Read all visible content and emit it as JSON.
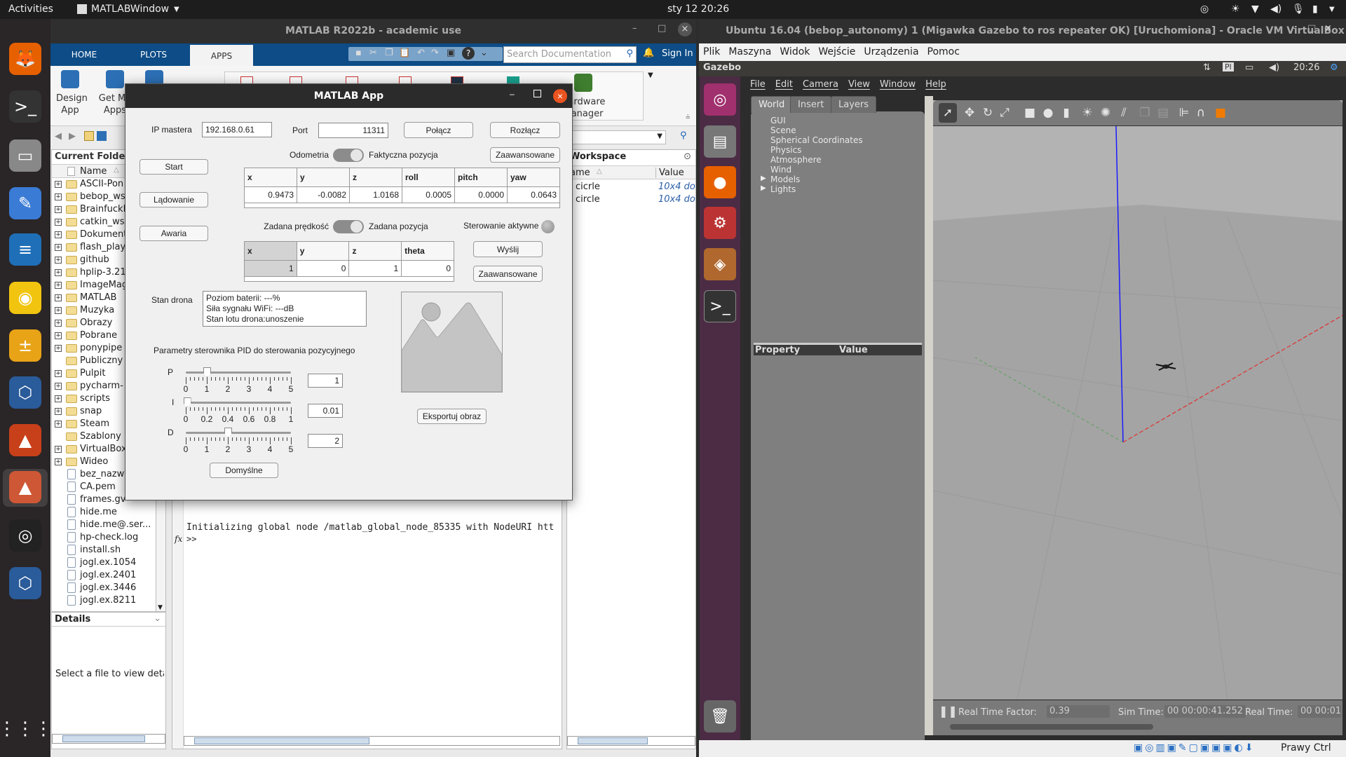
{
  "topbar": {
    "activities": "Activities",
    "app_menu": "MATLABWindow",
    "clock": "sty 12  20:26"
  },
  "dock": [
    {
      "name": "firefox-icon",
      "glyph": "🦊",
      "bg": "#e66000"
    },
    {
      "name": "terminal-icon",
      "glyph": ">_",
      "bg": "#333"
    },
    {
      "name": "files-icon",
      "glyph": "▭",
      "bg": "#888"
    },
    {
      "name": "text-editor-icon",
      "glyph": "✎",
      "bg": "#3a7bd5"
    },
    {
      "name": "writer-icon",
      "glyph": "≡",
      "bg": "#1f6fb8"
    },
    {
      "name": "rhythmbox-icon",
      "glyph": "◉",
      "bg": "#f1c40f"
    },
    {
      "name": "calculator-icon",
      "glyph": "±",
      "bg": "#e8a317"
    },
    {
      "name": "virtualbox-icon",
      "glyph": "⬡",
      "bg": "#2a5b9a"
    },
    {
      "name": "matlab-icon",
      "glyph": "▲",
      "bg": "#c8401a"
    },
    {
      "name": "matlab-active-icon",
      "glyph": "▲",
      "bg": "#c8401a"
    },
    {
      "name": "obs-icon",
      "glyph": "◎",
      "bg": "#222"
    },
    {
      "name": "virtualbox-2-icon",
      "glyph": "⬡",
      "bg": "#2a5b9a"
    }
  ],
  "matlab": {
    "title": "MATLAB R2022b - academic use",
    "tabs": [
      "HOME",
      "PLOTS",
      "APPS"
    ],
    "search_placeholder": "Search Documentation",
    "sign_in": "Sign In",
    "design_app": [
      "Design",
      "App"
    ],
    "get_more_apps": [
      "Get Mo",
      "Apps"
    ],
    "hardware_manager": [
      "Hardware",
      "Manager"
    ],
    "current_folder": "Current Folde",
    "name_col": "Name",
    "folders": [
      {
        "n": "ASCII-Pon",
        "e": 1
      },
      {
        "n": "bebop_ws",
        "e": 1
      },
      {
        "n": "BrainfuckN",
        "e": 1
      },
      {
        "n": "catkin_ws",
        "e": 1
      },
      {
        "n": "Dokument",
        "e": 1
      },
      {
        "n": "flash_play",
        "e": 1
      },
      {
        "n": "github",
        "e": 1
      },
      {
        "n": "hplip-3.21",
        "e": 1
      },
      {
        "n": "ImageMag",
        "e": 1
      },
      {
        "n": "MATLAB",
        "e": 1
      },
      {
        "n": "Muzyka",
        "e": 1
      },
      {
        "n": "Obrazy",
        "e": 1
      },
      {
        "n": "Pobrane",
        "e": 1
      },
      {
        "n": "ponypipe",
        "e": 1
      },
      {
        "n": "Publiczny",
        "e": 0
      },
      {
        "n": "Pulpit",
        "e": 1
      },
      {
        "n": "pycharm-",
        "e": 1
      },
      {
        "n": "scripts",
        "e": 1
      },
      {
        "n": "snap",
        "e": 1
      },
      {
        "n": "Steam",
        "e": 1
      },
      {
        "n": "Szablony",
        "e": 0
      },
      {
        "n": "VirtualBox",
        "e": 1
      },
      {
        "n": "Wideo",
        "e": 1
      }
    ],
    "files": [
      "bez_nazwy",
      "CA.pem",
      "frames.gv",
      "hide.me",
      "hide.me@.ser...",
      "hp-check.log",
      "install.sh",
      "jogl.ex.1054",
      "jogl.ex.2401",
      "jogl.ex.3446",
      "jogl.ex.8211"
    ],
    "details": "Details",
    "details_hint": "Select a file to view detai",
    "cmd_line": "Initializing global node /matlab_global_node_85335 with NodeURI htt",
    "prompt": ">>",
    "fx": "fx",
    "workspace": "Workspace",
    "ws_cols": [
      "ame",
      "Value"
    ],
    "ws_rows": [
      {
        "name": "cicrle",
        "value": "10x4 do"
      },
      {
        "name": "circle",
        "value": "10x4 do"
      }
    ]
  },
  "app": {
    "title": "MATLAB App",
    "ip_label": "IP mastera",
    "ip_value": "192.168.0.61",
    "port_label": "Port",
    "port_value": "11311",
    "connect": "Połącz",
    "disconnect": "Rozłącz",
    "start": "Start",
    "land": "Lądowanie",
    "emergency": "Awaria",
    "odom_left": "Odometria",
    "odom_right": "Faktyczna pozycja",
    "advanced": "Zaawansowane",
    "pose_table": {
      "cols": [
        "x",
        "y",
        "z",
        "roll",
        "pitch",
        "yaw"
      ],
      "values": [
        "0.9473",
        "-0.0082",
        "1.0168",
        "0.0005",
        "0.0000",
        "0.0643"
      ]
    },
    "cmd_left": "Zadana prędkość",
    "cmd_right": "Zadana pozycja",
    "control_active": "Sterowanie aktywne",
    "set_table": {
      "cols": [
        "x",
        "y",
        "z",
        "theta"
      ],
      "values": [
        "1",
        "0",
        "1",
        "0"
      ]
    },
    "send": "Wyślij",
    "advanced2": "Zaawansowane",
    "status_label": "Stan drona",
    "status_lines": [
      "Poziom baterii: ---%",
      "Siła sygnału WiFi: ---dB",
      "Stan lotu drona:unoszenie"
    ],
    "pid_title": "Parametry sterownika PID do sterowania pozycyjnego",
    "sliders": [
      {
        "label": "P",
        "min": 0,
        "max": 5,
        "value": 1,
        "ticks": [
          "0",
          "1",
          "2",
          "3",
          "4",
          "5"
        ],
        "field": "1"
      },
      {
        "label": "I",
        "min": 0,
        "max": 1,
        "value": 0.01,
        "ticks": [
          "0",
          "0.2",
          "0.4",
          "0.6",
          "0.8",
          "1"
        ],
        "field": "0.01"
      },
      {
        "label": "D",
        "min": 0,
        "max": 5,
        "value": 2,
        "ticks": [
          "0",
          "1",
          "2",
          "3",
          "4",
          "5"
        ],
        "field": "2"
      }
    ],
    "defaults": "Domyślne",
    "export": "Eksportuj obraz"
  },
  "vbox": {
    "title": "Ubuntu 16.04 (bebop_autonomy) 1 (Migawka Gazebo to ros repeater OK) [Uruchomiona] - Oracle VM VirtualBox",
    "menu": [
      "Plik",
      "Maszyna",
      "Widok",
      "Wejście",
      "Urządzenia",
      "Pomoc"
    ],
    "ubuntu_app": "Gazebo",
    "kbd": "Pl",
    "clock": "20:26",
    "status_key": "Prawy Ctrl"
  },
  "gazebo": {
    "menu": [
      "File",
      "Edit",
      "Camera",
      "View",
      "Window",
      "Help"
    ],
    "tabs": [
      "World",
      "Insert",
      "Layers"
    ],
    "tree": [
      "GUI",
      "Scene",
      "Spherical Coordinates",
      "Physics",
      "Atmosphere",
      "Wind",
      "Models",
      "Lights"
    ],
    "prop_cols": [
      "Property",
      "Value"
    ],
    "rtf_label": "Real Time Factor:",
    "rtf": "0.39",
    "sim_label": "Sim Time:",
    "sim": "00 00:00:41.252",
    "real_label": "Real Time:",
    "real": "00 00:01"
  }
}
